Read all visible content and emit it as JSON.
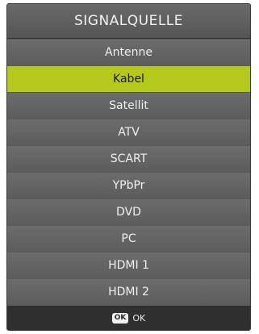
{
  "header": {
    "title": "SIGNALQUELLE"
  },
  "menu": {
    "items": [
      {
        "label": "Antenne"
      },
      {
        "label": "Kabel"
      },
      {
        "label": "Satellit"
      },
      {
        "label": "ATV"
      },
      {
        "label": "SCART"
      },
      {
        "label": "YPbPr"
      },
      {
        "label": "DVD"
      },
      {
        "label": "PC"
      },
      {
        "label": "HDMI 1"
      },
      {
        "label": "HDMI 2"
      }
    ],
    "selected_label": "Kabel"
  },
  "footer": {
    "ok_key": "OK",
    "ok_label": "OK"
  },
  "colors": {
    "panel": "#5a5a5a",
    "selected": "#b5c81c",
    "footer": "#2f2f2f"
  }
}
